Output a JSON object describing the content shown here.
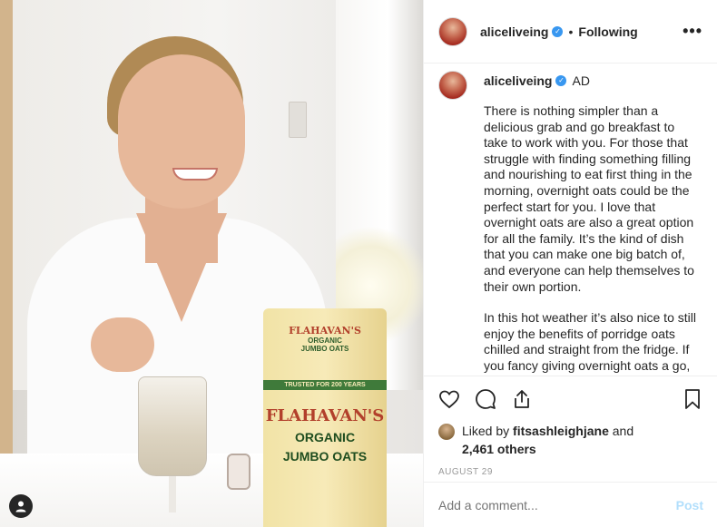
{
  "post": {
    "username": "aliceliveing",
    "follow_state": "Following",
    "more_label": "•••",
    "ad_label": "AD",
    "caption_paragraphs": [
      "There is nothing simpler than a delicious grab and go breakfast to take to work with you. For those that struggle with finding something filling and nourishing to eat first thing in the morning, overnight oats could be the perfect start for you. I love that overnight oats are also a great option for all the family. It’s the kind of dish that you can make one big batch of, and everyone can help themselves to their own portion.",
      "In this hot weather it’s also nice to still enjoy the benefits of porridge oats chilled and straight from the fridge. If you fancy giving overnight oats a go,"
    ],
    "liked_by_prefix": "Liked by",
    "liked_by_user": "fitsashleighjane",
    "liked_by_and": "and",
    "others_count": "2,461 others",
    "date": "AUGUST 29",
    "comment_placeholder": "Add a comment...",
    "post_label": "Post"
  },
  "photo": {
    "bag_brand_top": "FLAHAVAN'S",
    "bag_small_line1": "ORGANIC",
    "bag_small_line2": "JUMBO OATS",
    "bag_band": "TRUSTED FOR 200 YEARS",
    "bag_brand_big": "FLAHAVAN'S",
    "bag_product_line1": "ORGANIC",
    "bag_product_line2": "JUMBO OATS"
  },
  "colors": {
    "verified_blue": "#3897f0",
    "post_button_disabled": "#b2dffc",
    "text_primary": "#262626",
    "text_muted": "#999999"
  },
  "icons": [
    "heart-icon",
    "comment-icon",
    "share-icon",
    "bookmark-icon",
    "verified-icon",
    "more-icon",
    "user-icon"
  ]
}
